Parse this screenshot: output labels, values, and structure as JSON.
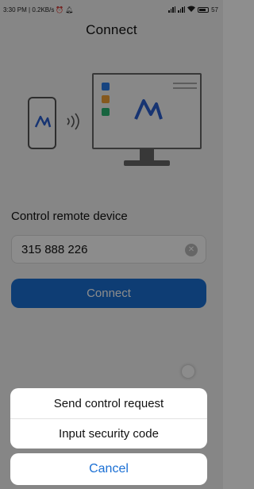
{
  "status_bar": {
    "time_speed": "3:30 PM | 0.2KB/s",
    "battery": "57"
  },
  "header": {
    "title": "Connect"
  },
  "main": {
    "section_title": "Control remote device",
    "device_id_value": "315 888 226",
    "connect_label": "Connect"
  },
  "action_sheet": {
    "items": [
      {
        "label": "Send control request"
      },
      {
        "label": "Input security code"
      }
    ],
    "cancel_label": "Cancel"
  },
  "colors": {
    "accent": "#1a6fd4",
    "monitor_squares": [
      "#2b7de9",
      "#f2a33a",
      "#2bb673"
    ]
  },
  "icons": [
    "anydesk-logo-icon",
    "signal-waves-icon",
    "clear-icon",
    "wifi-icon",
    "battery-icon",
    "alarm-icon",
    "bell-icon"
  ]
}
